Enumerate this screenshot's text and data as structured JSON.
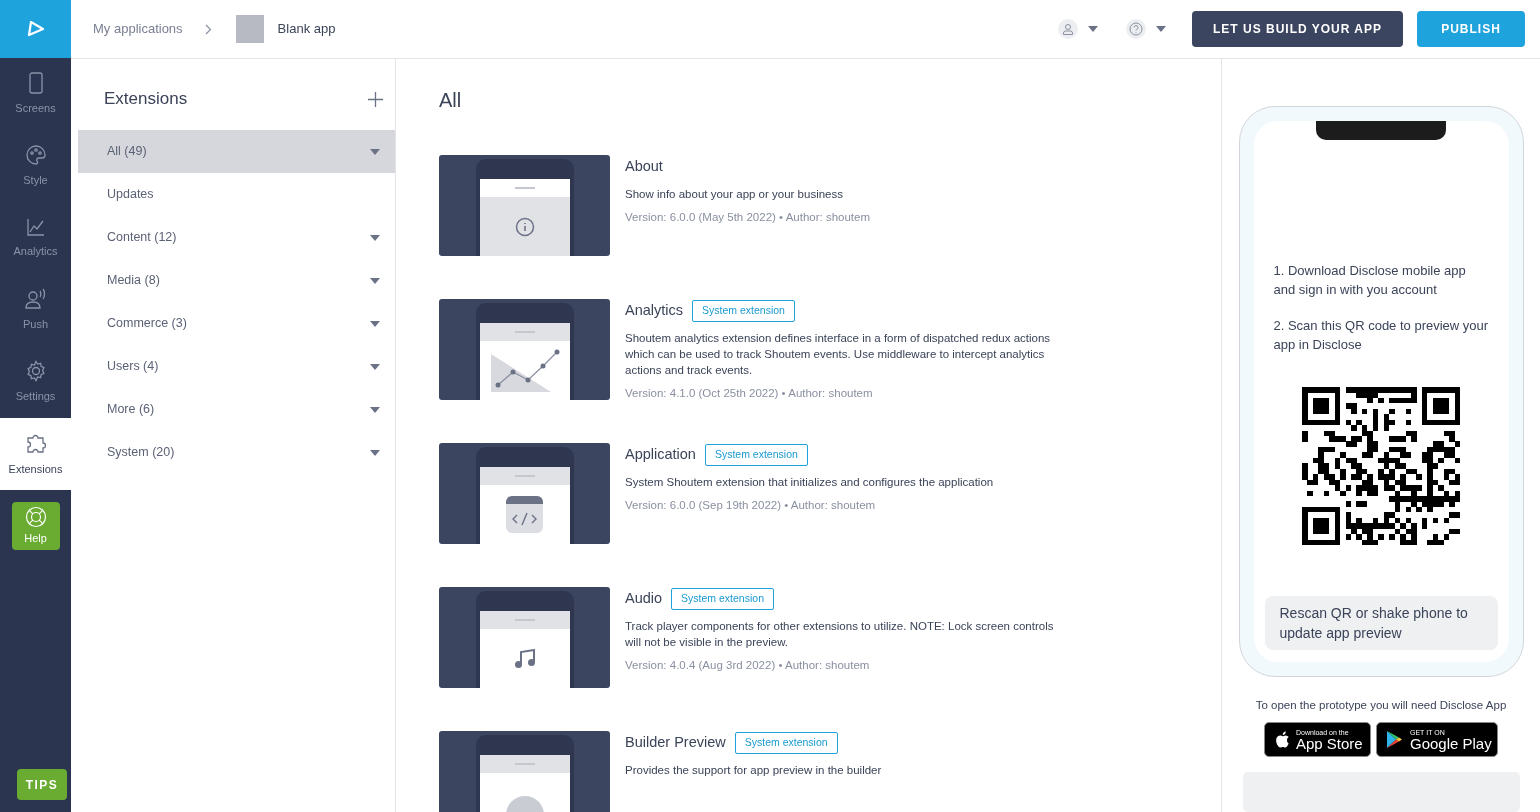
{
  "header": {
    "breadcrumb": "My applications",
    "app_name": "Blank app",
    "build_button": "LET US BUILD YOUR APP",
    "publish_button": "PUBLISH"
  },
  "rail": {
    "items": [
      {
        "label": "Screens",
        "kind": "phone",
        "selected": false
      },
      {
        "label": "Style",
        "kind": "palette",
        "selected": false
      },
      {
        "label": "Analytics",
        "kind": "chart",
        "selected": false
      },
      {
        "label": "Push",
        "kind": "push",
        "selected": false
      },
      {
        "label": "Settings",
        "kind": "gear",
        "selected": false
      },
      {
        "label": "Extensions",
        "kind": "puzzle",
        "selected": true
      }
    ],
    "help": "Help",
    "tips": "TIPS"
  },
  "categories": {
    "title": "Extensions",
    "items": [
      {
        "label": "All (49)",
        "expandable": true,
        "selected": true
      },
      {
        "label": "Updates",
        "expandable": false,
        "selected": false
      },
      {
        "label": "Content (12)",
        "expandable": true,
        "selected": false
      },
      {
        "label": "Media (8)",
        "expandable": true,
        "selected": false
      },
      {
        "label": "Commerce (3)",
        "expandable": true,
        "selected": false
      },
      {
        "label": "Users (4)",
        "expandable": true,
        "selected": false
      },
      {
        "label": "More (6)",
        "expandable": true,
        "selected": false
      },
      {
        "label": "System (20)",
        "expandable": true,
        "selected": false
      }
    ]
  },
  "main": {
    "title": "All",
    "extensions": [
      {
        "name": "About",
        "kind": "info",
        "description": "Show info about your app or your business",
        "version": "Version: 6.0.0 (May 5th 2022) • Author: shoutem"
      },
      {
        "name": "Analytics",
        "kind": "chart",
        "badge": "System extension",
        "description": "Shoutem analytics extension defines interface in a form of dispatched redux actions which can be used to track Shoutem events. Use middleware to intercept analytics actions and track events.",
        "version": "Version: 4.1.0 (Oct 25th 2022) • Author: shoutem"
      },
      {
        "name": "Application",
        "kind": "code",
        "badge": "System extension",
        "description": "System Shoutem extension that initializes and configures the application",
        "version": "Version: 6.0.0 (Sep 19th 2022) • Author: shoutem"
      },
      {
        "name": "Audio",
        "kind": "music",
        "badge": "System extension",
        "description": "Track player components for other extensions to utilize. NOTE: Lock screen controls will not be visible in the preview.",
        "version": "Version: 4.0.4 (Aug 3rd 2022) • Author: shoutem"
      },
      {
        "name": "Builder Preview",
        "kind": "circle",
        "badge": "System extension",
        "description": "Provides the support for app preview in the builder"
      }
    ]
  },
  "preview": {
    "steps": [
      "1. Download Disclose mobile app and sign in with you account",
      "2. Scan this QR code to preview your app in Disclose"
    ],
    "rescan": "Rescan QR or shake phone to update app preview",
    "caption": "To open the prototype you will need Disclose App",
    "app_store": {
      "small": "Download on the",
      "big": "App Store"
    },
    "google_play": {
      "small": "GET IT ON",
      "big": "Google Play"
    }
  }
}
